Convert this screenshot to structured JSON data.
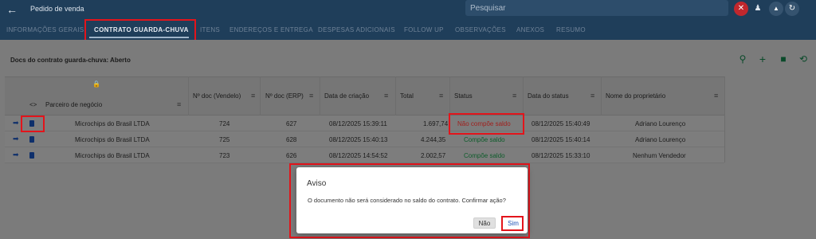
{
  "header": {
    "page_title": "Pedido de venda",
    "search_placeholder": "Pesquisar"
  },
  "tabs": [
    {
      "label": "INFORMAÇÕES GERAIS"
    },
    {
      "label": "CONTRATO GUARDA-CHUVA",
      "active": true
    },
    {
      "label": "ITENS"
    },
    {
      "label": "ENDEREÇOS E ENTREGA"
    },
    {
      "label": "DESPESAS ADICIONAIS"
    },
    {
      "label": "FOLLOW UP"
    },
    {
      "label": "OBSERVAÇÕES"
    },
    {
      "label": "ANEXOS"
    },
    {
      "label": "RESUMO"
    }
  ],
  "docs": {
    "title": "Docs do contrato guarda-chuva: Aberto"
  },
  "table": {
    "columns": {
      "code": "<>",
      "parceiro": "Parceiro de negócio",
      "doc_vendelo": "Nº doc (Vendelo)",
      "doc_erp": "Nº doc (ERP)",
      "data_criacao": "Data de criação",
      "total": "Total",
      "status": "Status",
      "data_status": "Data do status",
      "proprietario": "Nome do proprietário"
    },
    "rows": [
      {
        "parceiro": "Microchips do Brasil LTDA",
        "doc_vendelo": "724",
        "doc_erp": "627",
        "data_criacao": "08/12/2025 15:39:11",
        "total": "1.697,74",
        "status": "Não compõe saldo",
        "data_status": "08/12/2025 15:40:49",
        "proprietario": "Adriano Lourenço"
      },
      {
        "parceiro": "Microchips do Brasil LTDA",
        "doc_vendelo": "725",
        "doc_erp": "628",
        "data_criacao": "08/12/2025 15:40:13",
        "total": "4.244,35",
        "status": "Compõe saldo",
        "data_status": "08/12/2025 15:40:14",
        "proprietario": "Adriano Lourenço"
      },
      {
        "parceiro": "Microchips do Brasil LTDA",
        "doc_vendelo": "723",
        "doc_erp": "626",
        "data_criacao": "08/12/2025 14:54:52",
        "total": "2.002,57",
        "status": "Compõe saldo",
        "data_status": "08/12/2025 15:33:10",
        "proprietario": "Nenhum Vendedor"
      }
    ]
  },
  "dialog": {
    "title": "Aviso",
    "message": "O documento não será considerado no saldo do contrato. Confirmar ação?",
    "no_label": "Não",
    "yes_label": "Sim"
  },
  "colors": {
    "header_bg": "#1f3e5a",
    "status_ok": "#0f5d2c",
    "status_bad": "#a0211e",
    "highlight": "#e3141b"
  },
  "icons": [
    "back-arrow-icon",
    "notification-off-icon",
    "user-icon",
    "chevron-up-icon",
    "refresh-icon",
    "search-icon",
    "add-icon",
    "save-icon",
    "history-icon",
    "lock-icon",
    "column-menu-icon",
    "arrow-right-icon",
    "trash-icon"
  ]
}
